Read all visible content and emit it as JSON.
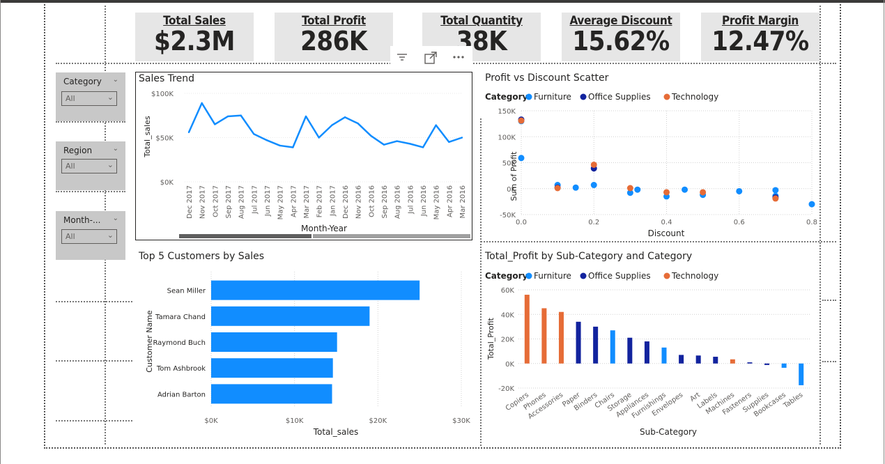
{
  "kpis": [
    {
      "title": "Total Sales",
      "value": "$2.3M"
    },
    {
      "title": "Total Profit",
      "value": "286K"
    },
    {
      "title": "Total Quantity",
      "value": "38K"
    },
    {
      "title": "Average Discount",
      "value": "15.62%"
    },
    {
      "title": "Profit Margin",
      "value": "12.47%"
    }
  ],
  "slicers": [
    {
      "title": "Category",
      "value": "All"
    },
    {
      "title": "Region",
      "value": "All"
    },
    {
      "title": "Month-...",
      "value": "All"
    }
  ],
  "toolbar": {
    "filter_icon": "filter-icon",
    "focus_icon": "focus-mode-icon",
    "more_icon": "more-options-icon"
  },
  "colors": {
    "furniture": "#118dff",
    "office_supplies": "#12239e",
    "technology": "#e66c37",
    "kpi_bg": "#e6e6e6",
    "slicer_bg": "#c8c8c8"
  },
  "chart_data": [
    {
      "id": "sales_trend",
      "type": "line",
      "title": "Sales Trend",
      "xlabel": "Month-Year",
      "ylabel": "Total_sales",
      "ylim": [
        0,
        100000
      ],
      "yticks": [
        {
          "v": 0,
          "label": "$0K"
        },
        {
          "v": 50000,
          "label": "$50K"
        },
        {
          "v": 100000,
          "label": "$100K"
        }
      ],
      "categories": [
        "Dec 2017",
        "Nov 2017",
        "Oct 2017",
        "Sep 2017",
        "Aug 2017",
        "Jul 2017",
        "Jun 2017",
        "May 2017",
        "Apr 2017",
        "Mar 2017",
        "Feb 2017",
        "Jan 2017",
        "Dec 2016",
        "Nov 2016",
        "Oct 2016",
        "Sep 2016",
        "Aug 2016",
        "Jul 2016",
        "Jun 2016",
        "May 2016",
        "Apr 2016",
        "Mar 2016"
      ],
      "values": [
        56000,
        89000,
        65000,
        74000,
        75000,
        54000,
        47000,
        41000,
        39000,
        74000,
        50000,
        64000,
        73000,
        66000,
        52000,
        42000,
        46000,
        43000,
        39000,
        64000,
        45000,
        50000
      ]
    },
    {
      "id": "profit_vs_discount",
      "type": "scatter",
      "title": "Profit vs Discount Scatter",
      "xlabel": "Discount",
      "ylabel": "Sum of Profit",
      "legend_title": "Category",
      "xlim": [
        0,
        0.8
      ],
      "ylim": [
        -50000,
        150000
      ],
      "xticks": [
        {
          "v": 0,
          "label": "0.0"
        },
        {
          "v": 0.2,
          "label": "0.2"
        },
        {
          "v": 0.4,
          "label": "0.4"
        },
        {
          "v": 0.6,
          "label": "0.6"
        },
        {
          "v": 0.8,
          "label": "0.8"
        }
      ],
      "yticks": [
        {
          "v": -50000,
          "label": "-50K"
        },
        {
          "v": 0,
          "label": "0K"
        },
        {
          "v": 50000,
          "label": "50K"
        },
        {
          "v": 100000,
          "label": "100K"
        },
        {
          "v": 150000,
          "label": "150K"
        }
      ],
      "series": [
        {
          "name": "Furniture",
          "color": "#118dff",
          "points": [
            [
              0,
              130000
            ],
            [
              0,
              59000
            ],
            [
              0.1,
              7000
            ],
            [
              0.15,
              2000
            ],
            [
              0.2,
              7000
            ],
            [
              0.3,
              -8000
            ],
            [
              0.32,
              -2000
            ],
            [
              0.4,
              -15000
            ],
            [
              0.45,
              -2000
            ],
            [
              0.5,
              -12000
            ],
            [
              0.6,
              -5000
            ],
            [
              0.7,
              -3000
            ],
            [
              0.7,
              -14000
            ],
            [
              0.8,
              -30000
            ]
          ]
        },
        {
          "name": "Office Supplies",
          "color": "#12239e",
          "points": [
            [
              0,
              133000
            ],
            [
              0.1,
              2000
            ],
            [
              0.2,
              39000
            ],
            [
              0.7,
              -17000
            ]
          ]
        },
        {
          "name": "Technology",
          "color": "#e66c37",
          "points": [
            [
              0,
              131000
            ],
            [
              0.1,
              1000
            ],
            [
              0.2,
              46000
            ],
            [
              0.3,
              1000
            ],
            [
              0.4,
              -7000
            ],
            [
              0.5,
              -7000
            ],
            [
              0.7,
              -19000
            ]
          ]
        }
      ]
    },
    {
      "id": "top5_customers",
      "type": "bar",
      "title": "Top 5 Customers by Sales",
      "xlabel": "Total_sales",
      "ylabel": "Customer Name",
      "xlim": [
        0,
        30000
      ],
      "xticks": [
        {
          "v": 0,
          "label": "$0K"
        },
        {
          "v": 10000,
          "label": "$10K"
        },
        {
          "v": 20000,
          "label": "$20K"
        },
        {
          "v": 30000,
          "label": "$30K"
        }
      ],
      "categories": [
        "Sean Miller",
        "Tamara Chand",
        "Raymond Buch",
        "Tom Ashbrook",
        "Adrian Barton"
      ],
      "values": [
        25000,
        19000,
        15100,
        14600,
        14500
      ]
    },
    {
      "id": "profit_by_subcategory",
      "type": "bar",
      "title": "Total_Profit by Sub-Category and Category",
      "xlabel": "Sub-Category",
      "ylabel": "Total_Profit",
      "legend_title": "Category",
      "legend": [
        {
          "name": "Furniture",
          "color": "#118dff"
        },
        {
          "name": "Office Supplies",
          "color": "#12239e"
        },
        {
          "name": "Technology",
          "color": "#e66c37"
        }
      ],
      "ylim": [
        -20000,
        60000
      ],
      "yticks": [
        {
          "v": -20000,
          "label": "-20K"
        },
        {
          "v": 0,
          "label": "0K"
        },
        {
          "v": 20000,
          "label": "20K"
        },
        {
          "v": 40000,
          "label": "40K"
        },
        {
          "v": 60000,
          "label": "60K"
        }
      ],
      "categories": [
        "Copiers",
        "Phones",
        "Accessories",
        "Paper",
        "Binders",
        "Chairs",
        "Storage",
        "Appliances",
        "Furnishings",
        "Envelopes",
        "Art",
        "Labels",
        "Machines",
        "Fasteners",
        "Supplies",
        "Bookcases",
        "Tables"
      ],
      "bar_series": [
        "Technology",
        "Technology",
        "Technology",
        "Office Supplies",
        "Office Supplies",
        "Furniture",
        "Office Supplies",
        "Office Supplies",
        "Furniture",
        "Office Supplies",
        "Office Supplies",
        "Office Supplies",
        "Technology",
        "Office Supplies",
        "Office Supplies",
        "Furniture",
        "Furniture"
      ],
      "values": [
        56000,
        45000,
        42000,
        34000,
        30000,
        27000,
        21000,
        18000,
        13000,
        7000,
        6500,
        5500,
        3400,
        950,
        -1200,
        -3500,
        -17700
      ]
    }
  ]
}
